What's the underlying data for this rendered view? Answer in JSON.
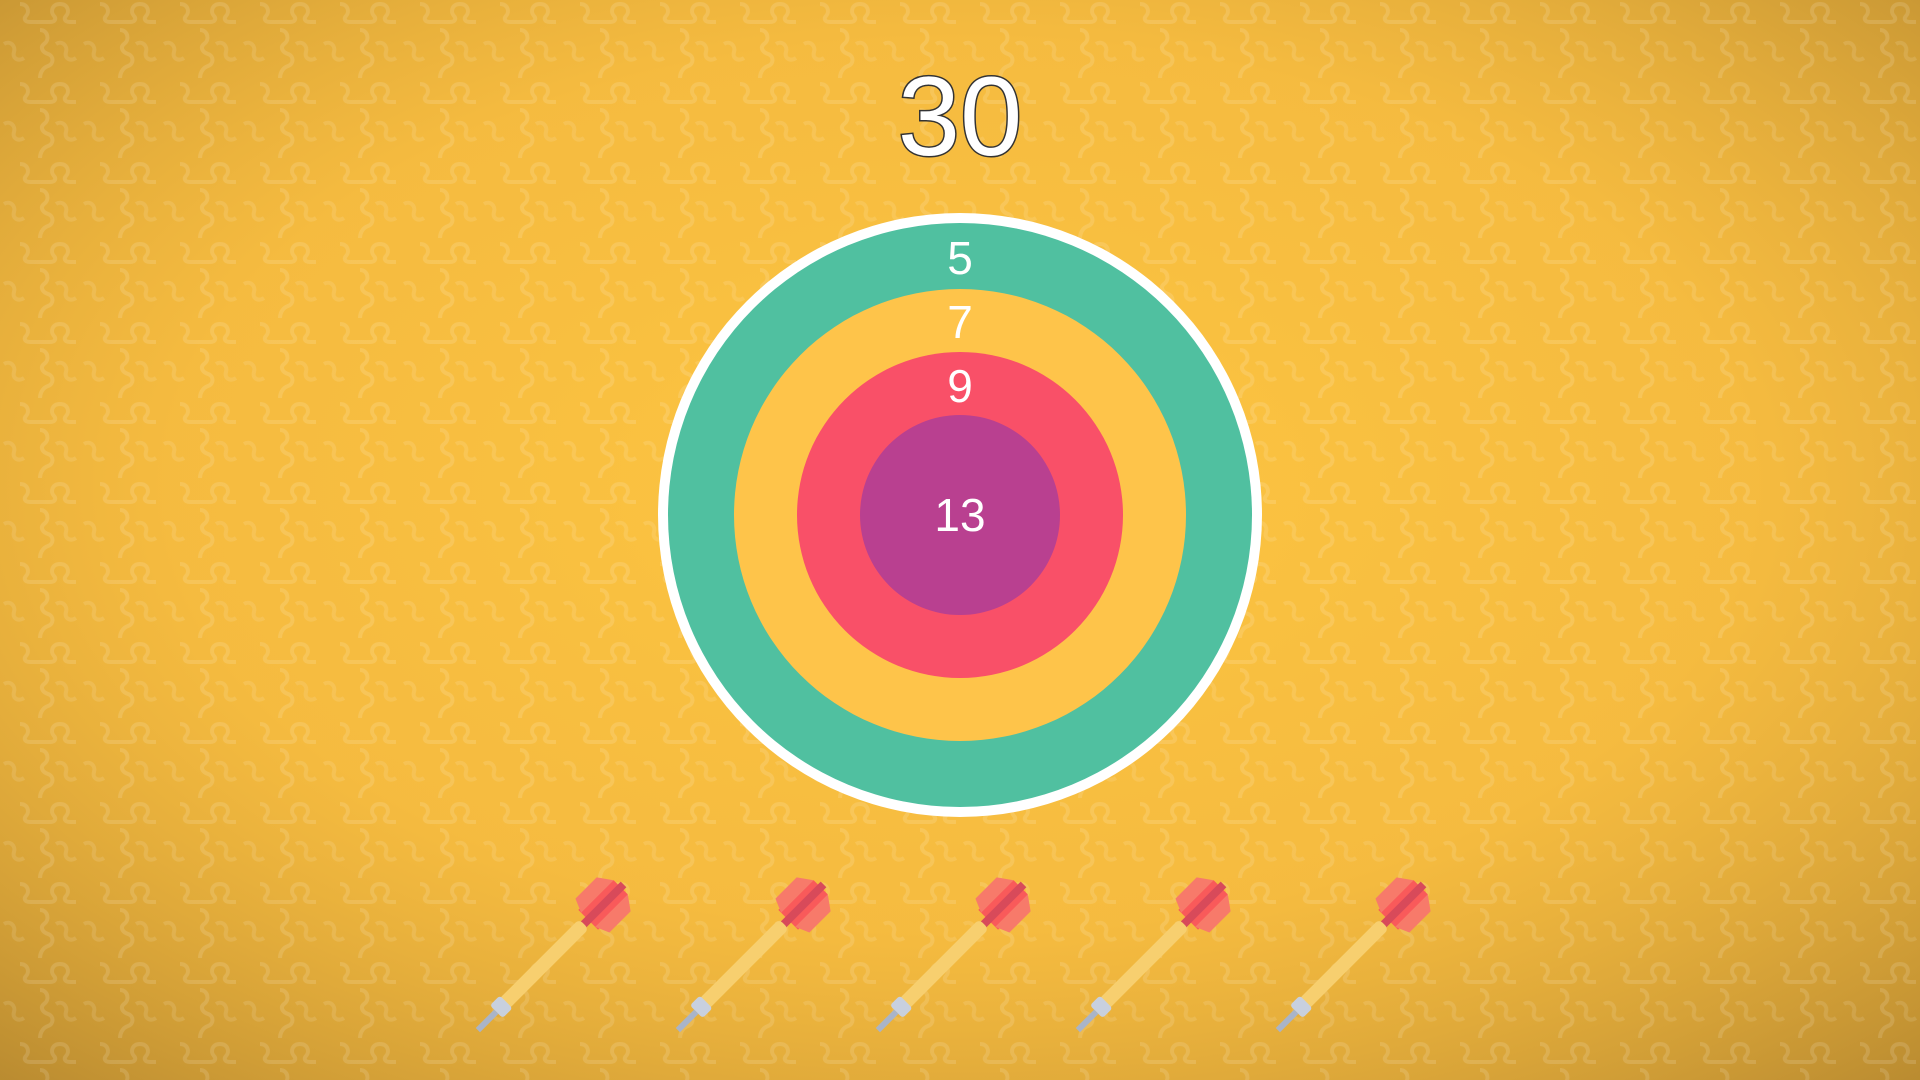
{
  "game": {
    "target_score": "30",
    "board": {
      "rings": [
        {
          "points": "5",
          "color": "#50c0a0"
        },
        {
          "points": "7",
          "color": "#fec44a"
        },
        {
          "points": "9",
          "color": "#f95068"
        },
        {
          "points": "13",
          "color": "#b94090"
        }
      ],
      "border_color": "#ffffff"
    },
    "darts_remaining": 5,
    "dart_icon": "dart-icon"
  },
  "colors": {
    "background": "#f4bb40",
    "background_vignette": "#b88a30",
    "dart_flight": "#f95a5a",
    "dart_shaft": "#f7cf6f",
    "dart_tip": "#a9b4c8"
  }
}
